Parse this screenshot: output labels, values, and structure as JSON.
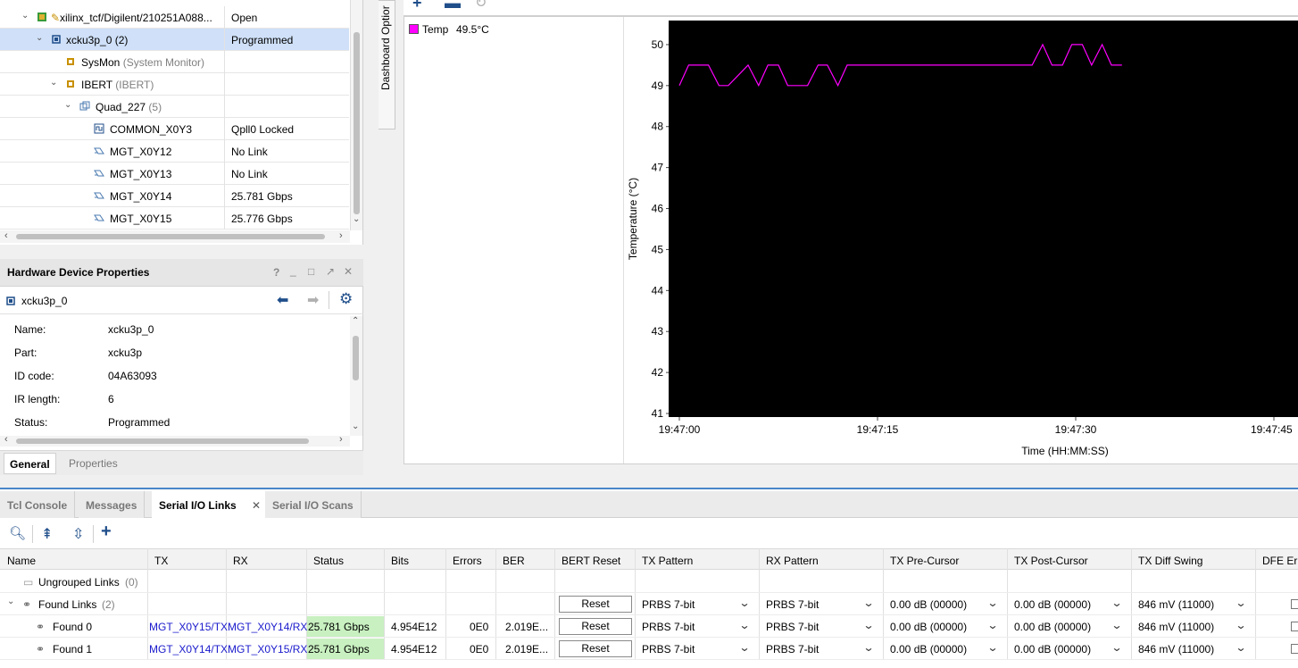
{
  "hardware_tree": {
    "rows": [
      {
        "name": "xilinx_tcf/Digilent/210251A088...",
        "status": "Open"
      },
      {
        "name": "xcku3p_0 (2)",
        "status": "Programmed"
      },
      {
        "name": "SysMon",
        "suffix": "(System Monitor)",
        "status": ""
      },
      {
        "name": "IBERT",
        "suffix": "(IBERT)",
        "status": ""
      },
      {
        "name": "Quad_227",
        "suffix": "(5)",
        "status": ""
      },
      {
        "name": "COMMON_X0Y3",
        "status": "Qpll0 Locked"
      },
      {
        "name": "MGT_X0Y12",
        "status": "No Link"
      },
      {
        "name": "MGT_X0Y13",
        "status": "No Link"
      },
      {
        "name": "MGT_X0Y14",
        "status": "25.781 Gbps"
      },
      {
        "name": "MGT_X0Y15",
        "status": "25.776 Gbps"
      }
    ]
  },
  "properties": {
    "title": "Hardware Device Properties",
    "device": "xcku3p_0",
    "rows": [
      {
        "key": "Name:",
        "value": "xcku3p_0"
      },
      {
        "key": "Part:",
        "value": "xcku3p"
      },
      {
        "key": "ID code:",
        "value": "04A63093"
      },
      {
        "key": "IR length:",
        "value": "6"
      },
      {
        "key": "Status:",
        "value": "Programmed"
      }
    ],
    "tabs": [
      "General",
      "Properties"
    ],
    "title_buttons": [
      "?",
      "_",
      "□",
      "↗",
      "✕"
    ]
  },
  "dashboard": {
    "side_tab": "Dashboard Optior",
    "legend": {
      "label": "Temp",
      "value": "49.5°C",
      "color": "#ff00ff"
    }
  },
  "chart_data": {
    "type": "line",
    "xlabel": "Time (HH:MM:SS)",
    "ylabel": "Temperature (°C)",
    "ylim": [
      41,
      50.5
    ],
    "y_ticks": [
      41,
      42,
      43,
      44,
      45,
      46,
      47,
      48,
      49,
      50
    ],
    "x_ticks": [
      "19:47:00",
      "19:47:15",
      "19:47:30",
      "19:47:45"
    ],
    "xlim_seconds": [
      0,
      45
    ],
    "background": "#000000",
    "series": [
      {
        "name": "Temp",
        "color": "#ff00ff",
        "x": [
          0,
          0.7,
          2.2,
          3,
          3.7,
          5.2,
          6,
          6.7,
          7.5,
          8.2,
          9.7,
          10.5,
          11.2,
          12,
          12.7,
          14.2,
          15,
          16.5,
          26.7,
          27.5,
          28.2,
          29,
          29.7,
          30.5,
          31.2,
          32,
          32.7,
          33.5
        ],
        "y": [
          49,
          49.5,
          49.5,
          49,
          49,
          49.5,
          49,
          49.5,
          49.5,
          49,
          49,
          49.5,
          49.5,
          49,
          49.5,
          49.5,
          49.5,
          49.5,
          49.5,
          50,
          49.5,
          49.5,
          50,
          50,
          49.5,
          50,
          49.5,
          49.5
        ]
      }
    ]
  },
  "bottom_tabs": [
    "Tcl Console",
    "Messages",
    "Serial I/O Links",
    "Serial I/O Scans"
  ],
  "active_bottom_tab": "Serial I/O Links",
  "links_table": {
    "headers": [
      "Name",
      "TX",
      "RX",
      "Status",
      "Bits",
      "Errors",
      "BER",
      "BERT Reset",
      "TX Pattern",
      "RX Pattern",
      "TX Pre-Cursor",
      "TX Post-Cursor",
      "TX Diff Swing",
      "DFE Er"
    ],
    "ungrouped": {
      "label": "Ungrouped Links",
      "count": "(0)"
    },
    "found_group": {
      "label": "Found Links",
      "count": "(2)",
      "reset": "Reset",
      "tx_pattern": "PRBS 7-bit",
      "rx_pattern": "PRBS 7-bit",
      "pre": "0.00 dB (00000)",
      "post": "0.00 dB (00000)",
      "swing": "846 mV (11000)"
    },
    "rows": [
      {
        "name": "Found 0",
        "tx": "MGT_X0Y15/TX",
        "rx": "MGT_X0Y14/RX",
        "status": "25.781 Gbps",
        "bits": "4.954E12",
        "errors": "0E0",
        "ber": "2.019E...",
        "reset": "Reset",
        "tx_pattern": "PRBS 7-bit",
        "rx_pattern": "PRBS 7-bit",
        "pre": "0.00 dB (00000)",
        "post": "0.00 dB (00000)",
        "swing": "846 mV (11000)"
      },
      {
        "name": "Found 1",
        "tx": "MGT_X0Y14/TX",
        "rx": "MGT_X0Y15/RX",
        "status": "25.781 Gbps",
        "bits": "4.954E12",
        "errors": "0E0",
        "ber": "2.019E...",
        "reset": "Reset",
        "tx_pattern": "PRBS 7-bit",
        "rx_pattern": "PRBS 7-bit",
        "pre": "0.00 dB (00000)",
        "post": "0.00 dB (00000)",
        "swing": "846 mV (11000)"
      }
    ]
  }
}
